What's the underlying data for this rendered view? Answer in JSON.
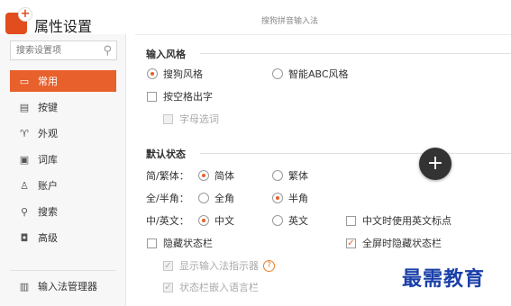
{
  "window": {
    "title": "属性设置",
    "caption": "搜狗拼音输入法"
  },
  "sidebar": {
    "search_placeholder": "搜索设置项",
    "items": [
      {
        "label": "常用",
        "icon": "monitor-icon",
        "active": true
      },
      {
        "label": "按键",
        "icon": "keyboard-icon"
      },
      {
        "label": "外观",
        "icon": "shirt-icon"
      },
      {
        "label": "词库",
        "icon": "book-icon"
      },
      {
        "label": "账户",
        "icon": "user-icon"
      },
      {
        "label": "搜索",
        "icon": "search-icon"
      },
      {
        "label": "高级",
        "icon": "advanced-icon"
      }
    ],
    "manager_label": "输入法管理器"
  },
  "input_style": {
    "title": "输入风格",
    "option_sogou": "搜狗风格",
    "option_smart": "智能ABC风格",
    "selected": "搜狗风格",
    "space_output": "按空格出字",
    "letter_select": "字母选词"
  },
  "default_state": {
    "title": "默认状态",
    "simp_trad_label": "简/繁体：",
    "simp": "简体",
    "trad": "繁体",
    "full_half_label": "全/半角：",
    "full": "全角",
    "half": "半角",
    "cn_en_label": "中/英文：",
    "cn": "中文",
    "en": "英文",
    "en_punct": "中文时使用英文标点",
    "hide_status": "隐藏状态栏",
    "fullscreen_hide": "全屏时隐藏状态栏",
    "show_indicator": "显示输入法指示器",
    "embed_lang": "状态栏嵌入语言栏"
  },
  "watermark": "最需教育",
  "colors": {
    "accent": "#e8602c",
    "watermark": "#1a3fa8"
  }
}
